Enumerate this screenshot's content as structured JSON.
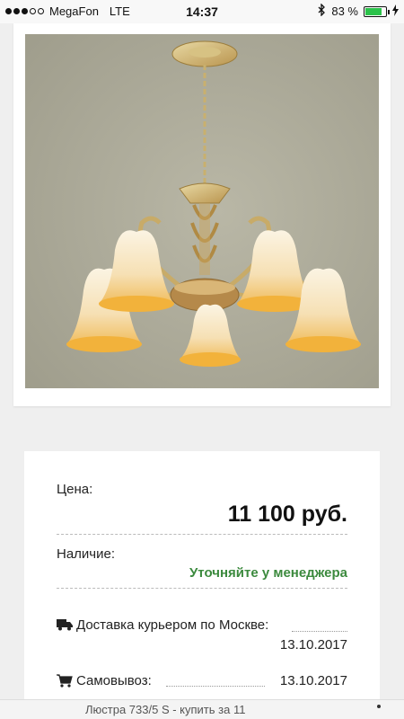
{
  "status_bar": {
    "carrier": "MegaFon",
    "network": "LTE",
    "time": "14:37",
    "battery_percent": "83 %",
    "battery_level": 0.83
  },
  "product": {
    "image_alt": "chandelier-photo"
  },
  "price": {
    "label": "Цена:",
    "value": "11 100 руб."
  },
  "availability": {
    "label": "Наличие:",
    "value": "Уточняйте у менеджера"
  },
  "delivery": {
    "courier_label": "Доставка курьером по Москве:",
    "courier_date": "13.10.2017",
    "pickup_label": "Самовывоз:",
    "pickup_date": "13.10.2017"
  },
  "bottom_bar": {
    "title": "Люстра 733/5 S - купить за 11"
  },
  "colors": {
    "accent_green": "#3c8a3e",
    "battery_green": "#2bc24a"
  }
}
